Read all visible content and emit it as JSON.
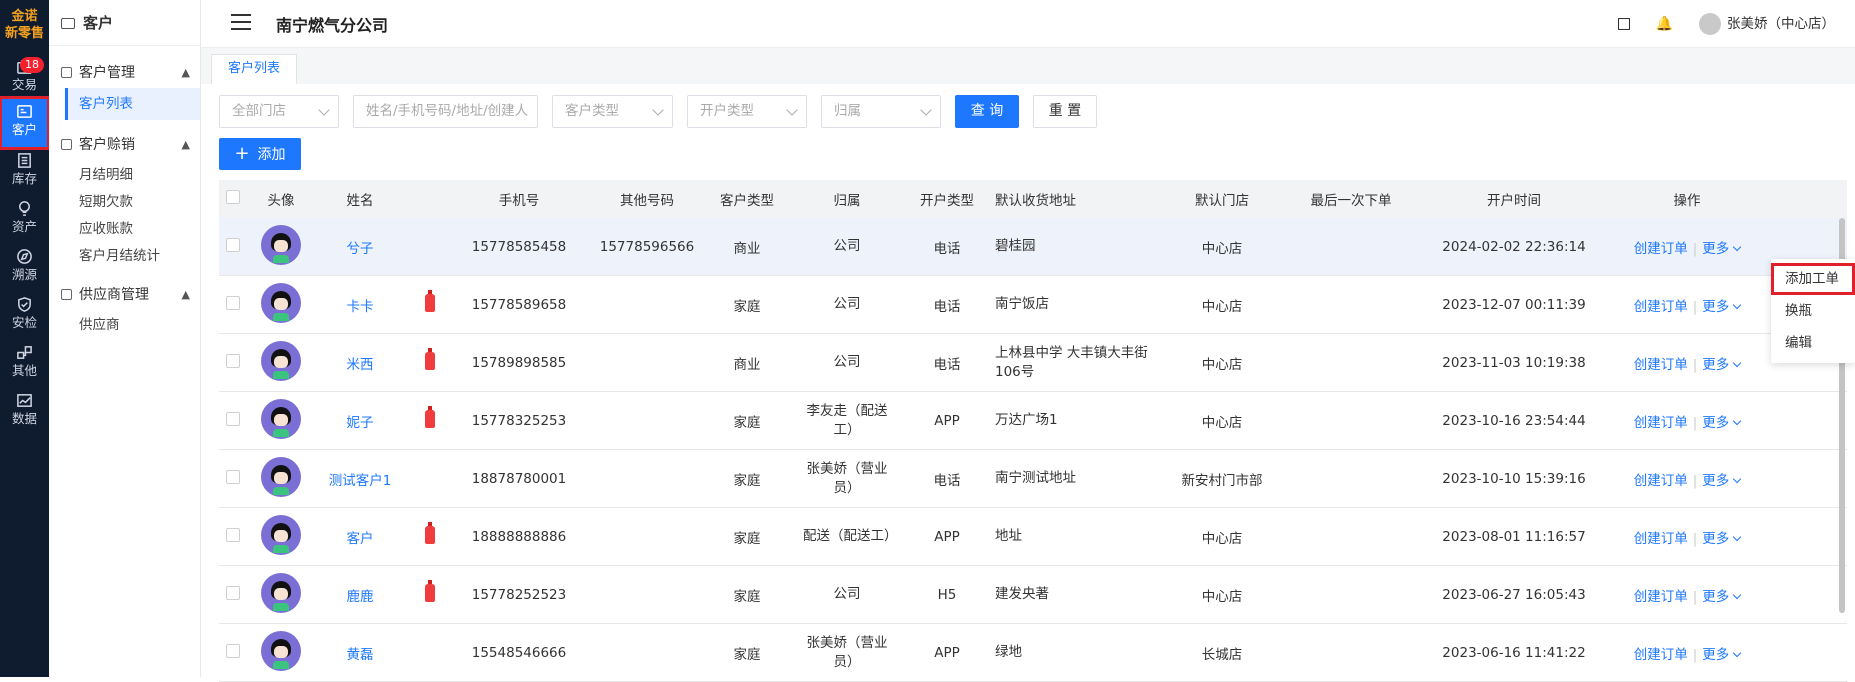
{
  "rail": {
    "logo_line1": "金诺",
    "logo_line2": "新零售",
    "badge": "18",
    "items": [
      {
        "label": "交易",
        "icon": "trade-icon"
      },
      {
        "label": "客户",
        "icon": "customer-icon"
      },
      {
        "label": "库存",
        "icon": "inventory-icon"
      },
      {
        "label": "资产",
        "icon": "asset-icon"
      },
      {
        "label": "溯源",
        "icon": "trace-icon"
      },
      {
        "label": "安检",
        "icon": "safety-icon"
      },
      {
        "label": "其他",
        "icon": "other-icon"
      },
      {
        "label": "数据",
        "icon": "data-icon"
      }
    ]
  },
  "side": {
    "title": "客户",
    "groups": [
      {
        "label": "客户管理",
        "items": [
          "客户列表"
        ]
      },
      {
        "label": "客户赊销",
        "items": [
          "月结明细",
          "短期欠款",
          "应收账款",
          "客户月结统计"
        ]
      },
      {
        "label": "供应商管理",
        "items": [
          "供应商"
        ]
      }
    ]
  },
  "top": {
    "company": "南宁燃气分公司",
    "user": "张美娇（中心店）"
  },
  "tab": "客户列表",
  "filters": {
    "store": "全部门店",
    "search": "姓名/手机号码/地址/创建人",
    "customer_type": "客户类型",
    "account_type": "开户类型",
    "belong": "归属",
    "query": "查 询",
    "reset": "重 置",
    "add": "添加"
  },
  "table": {
    "headers": [
      "头像",
      "姓名",
      "手机号",
      "其他号码",
      "客户类型",
      "归属",
      "开户类型",
      "默认收货地址",
      "默认门店",
      "最后一次下单",
      "开户时间",
      "操作"
    ],
    "create_order": "创建订单",
    "more": "更多",
    "rows": [
      {
        "name": "兮子",
        "gas": false,
        "phone": "15778585458",
        "other": "15778596566",
        "ctype": "商业",
        "belong": "公司",
        "atype": "电话",
        "address": "碧桂园",
        "store": "中心店",
        "last": "",
        "time": "2024-02-02 22:36:14"
      },
      {
        "name": "卡卡",
        "gas": true,
        "phone": "15778589658",
        "other": "",
        "ctype": "家庭",
        "belong": "公司",
        "atype": "电话",
        "address": "南宁饭店",
        "store": "中心店",
        "last": "",
        "time": "2023-12-07 00:11:39"
      },
      {
        "name": "米西",
        "gas": true,
        "phone": "15789898585",
        "other": "",
        "ctype": "商业",
        "belong": "公司",
        "atype": "电话",
        "address": "上林县中学 大丰镇大丰街106号",
        "store": "中心店",
        "last": "",
        "time": "2023-11-03 10:19:38"
      },
      {
        "name": "妮子",
        "gas": true,
        "phone": "15778325253",
        "other": "",
        "ctype": "家庭",
        "belong": "李友走（配送工）",
        "atype": "APP",
        "address": "万达广场1",
        "store": "中心店",
        "last": "",
        "time": "2023-10-16 23:54:44"
      },
      {
        "name": "测试客户1",
        "gas": false,
        "phone": "18878780001",
        "other": "",
        "ctype": "家庭",
        "belong": "张美娇（营业员）",
        "atype": "电话",
        "address": "南宁测试地址",
        "store": "新安村门市部",
        "last": "",
        "time": "2023-10-10 15:39:16"
      },
      {
        "name": "客户",
        "gas": true,
        "phone": "18888888886",
        "other": "",
        "ctype": "家庭",
        "belong": "配送（配送工）",
        "atype": "APP",
        "address": "地址",
        "store": "中心店",
        "last": "",
        "time": "2023-08-01 11:16:57"
      },
      {
        "name": "鹿鹿",
        "gas": true,
        "phone": "15778252523",
        "other": "",
        "ctype": "家庭",
        "belong": "公司",
        "atype": "H5",
        "address": "建发央著",
        "store": "中心店",
        "last": "",
        "time": "2023-06-27 16:05:43"
      },
      {
        "name": "黄磊",
        "gas": false,
        "phone": "15548546666",
        "other": "",
        "ctype": "家庭",
        "belong": "张美娇（营业员）",
        "atype": "APP",
        "address": "绿地",
        "store": "长城店",
        "last": "",
        "time": "2023-06-16 11:41:22"
      }
    ]
  },
  "dropdown": [
    "添加工单",
    "换瓶",
    "编辑"
  ]
}
